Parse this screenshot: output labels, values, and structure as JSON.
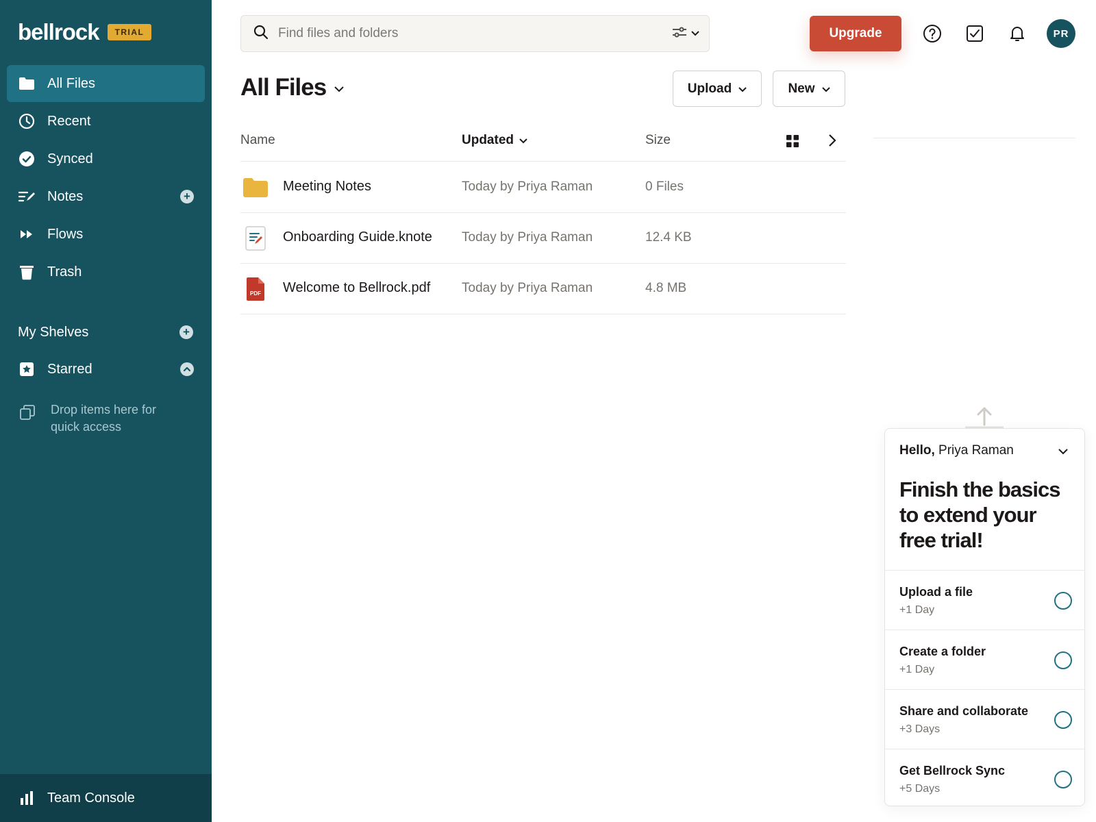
{
  "brand": {
    "name": "bellrock",
    "badge": "TRIAL"
  },
  "colors": {
    "sidebar": "#17525f",
    "active": "#1f7183",
    "accent": "#c94a35",
    "badge": "#e2aa30"
  },
  "sidebar": {
    "items": [
      {
        "label": "All Files",
        "icon": "folder-icon",
        "active": true
      },
      {
        "label": "Recent",
        "icon": "clock-icon"
      },
      {
        "label": "Synced",
        "icon": "check-circle-icon"
      },
      {
        "label": "Notes",
        "icon": "notes-icon",
        "has_add": true
      },
      {
        "label": "Flows",
        "icon": "fast-forward-icon"
      },
      {
        "label": "Trash",
        "icon": "trash-icon"
      }
    ],
    "shelves_label": "My Shelves",
    "starred_label": "Starred",
    "drop_hint": "Drop items here for quick access",
    "team_console": "Team Console"
  },
  "search": {
    "placeholder": "Find files and folders"
  },
  "header": {
    "upgrade": "Upgrade",
    "avatar_initials": "PR"
  },
  "main": {
    "title": "All Files",
    "upload_label": "Upload",
    "new_label": "New",
    "columns": {
      "name": "Name",
      "updated": "Updated",
      "size": "Size"
    },
    "files": [
      {
        "name": "Meeting Notes",
        "type": "folder",
        "updated": "Today by Priya Raman",
        "size": "0 Files"
      },
      {
        "name": "Onboarding Guide.knote",
        "type": "note",
        "updated": "Today by Priya Raman",
        "size": "12.4 KB"
      },
      {
        "name": "Welcome to Bellrock.pdf",
        "type": "pdf",
        "updated": "Today by Priya Raman",
        "size": "4.8 MB"
      }
    ]
  },
  "onboarding": {
    "greeting_bold": "Hello,",
    "greeting_name": "Priya Raman",
    "title": "Finish the basics to extend your free trial!",
    "tasks": [
      {
        "title": "Upload a file",
        "reward": "+1 Day"
      },
      {
        "title": "Create a folder",
        "reward": "+1 Day"
      },
      {
        "title": "Share and collaborate",
        "reward": "+3 Days"
      },
      {
        "title": "Get Bellrock Sync",
        "reward": "+5 Days"
      }
    ]
  }
}
